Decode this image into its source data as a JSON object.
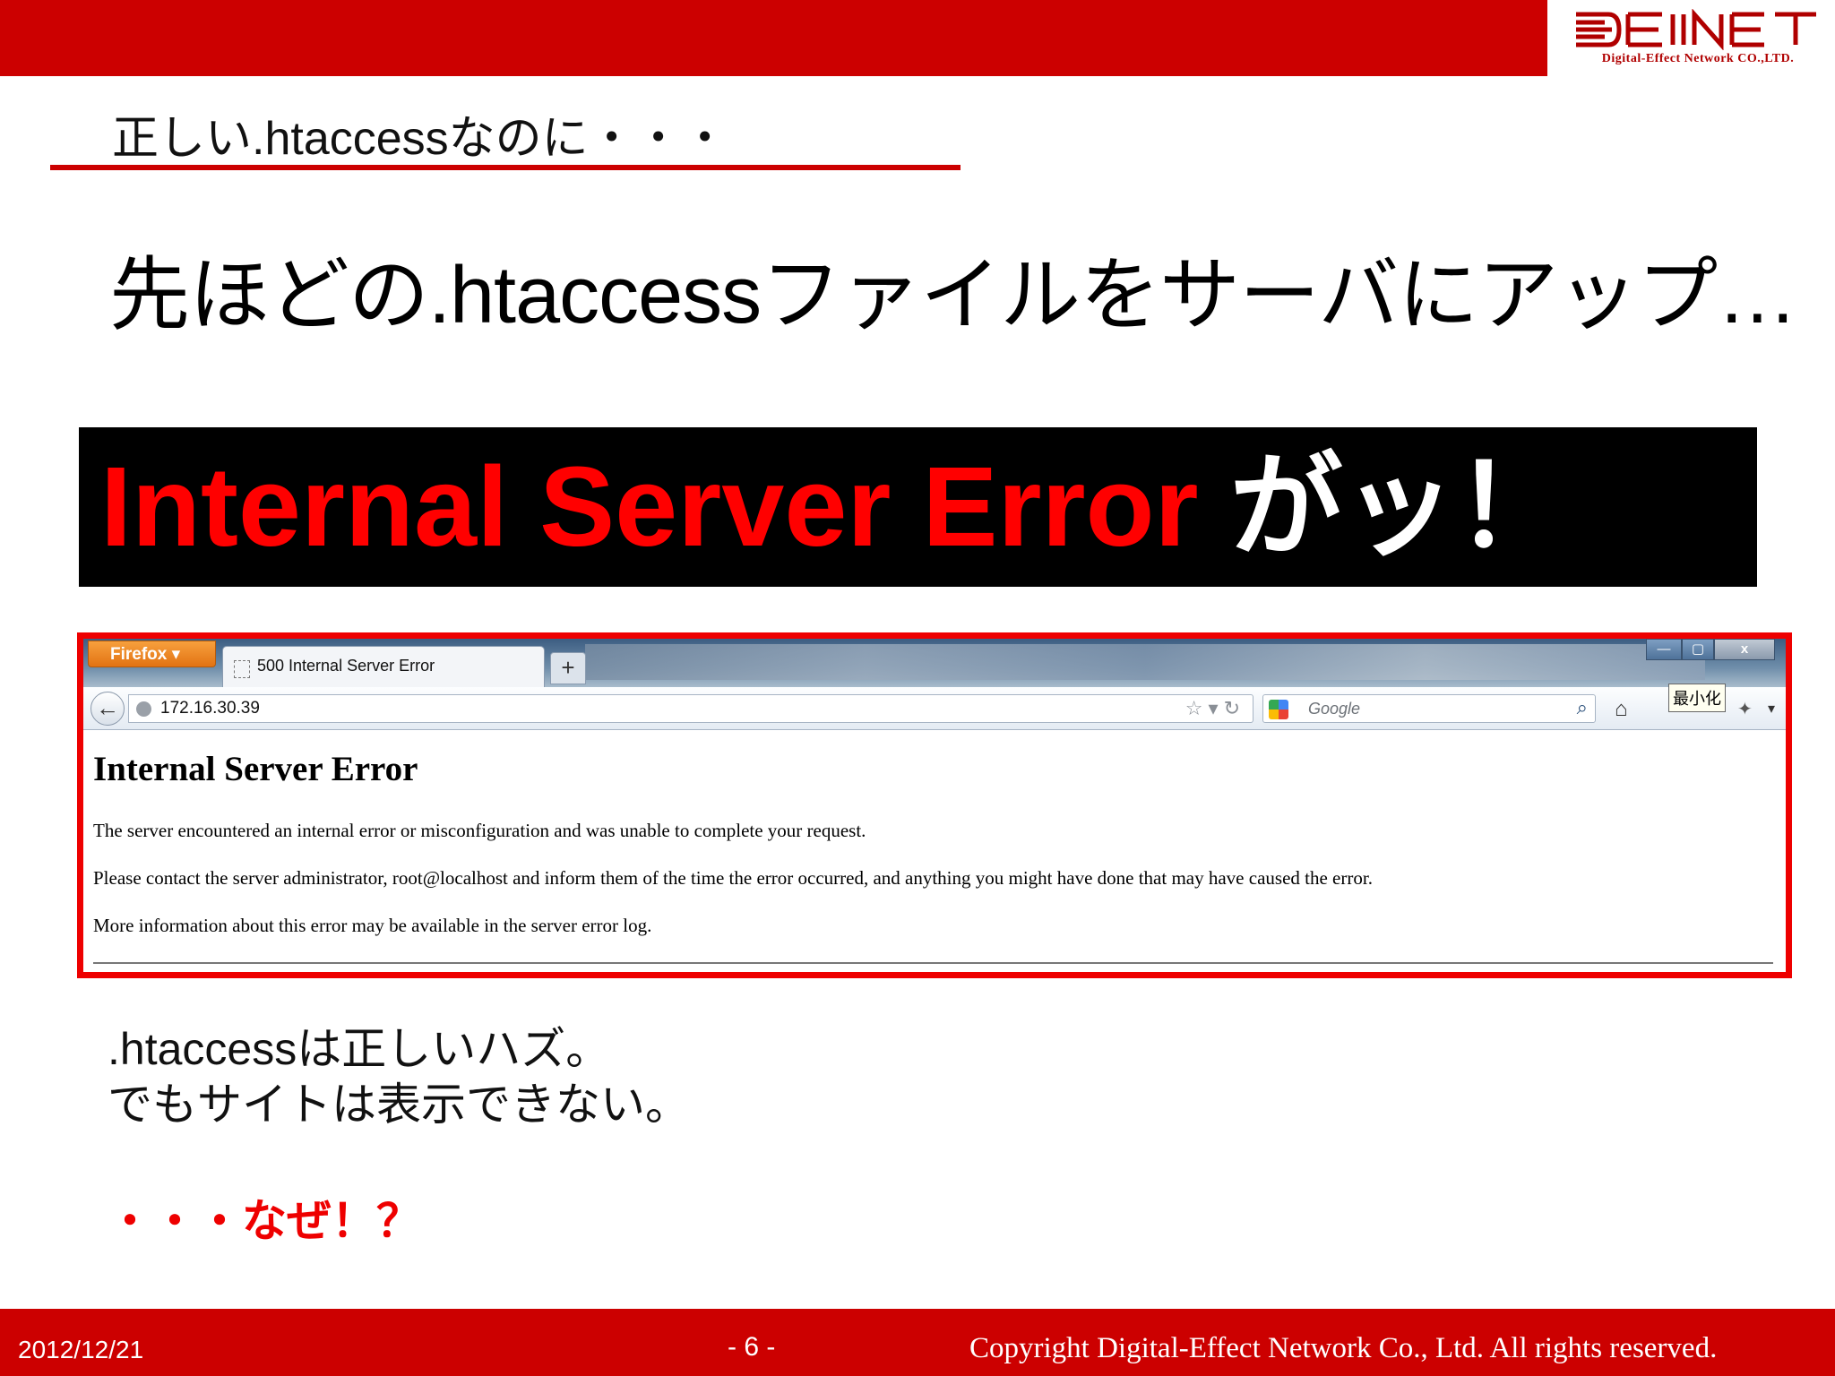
{
  "header": {
    "logo_text": "Digital-Effect Network CO.,LTD.",
    "bar_color": "#cc0000"
  },
  "slide": {
    "section_title": "正しい.htaccessなのに・・・",
    "lead": "先ほどの.htaccessファイルをサーバにアップ…",
    "banner_red": "Internal Server Error",
    "banner_white": "がッ！",
    "note_line1": ".htaccessは正しいハズ。",
    "note_line2": "でもサイトは表示できない。",
    "why": "・・・なぜ！？"
  },
  "browser": {
    "app_button": "Firefox",
    "tab_title": "500 Internal Server Error",
    "new_tab": "+",
    "url": "172.16.30.39",
    "search_placeholder": "Google",
    "tooltip": "最小化",
    "window_controls": {
      "minimize": "—",
      "maximize": "▢",
      "close": "x"
    },
    "icons": [
      "back-arrow-icon",
      "globe-icon",
      "star-icon",
      "dropdown-icon",
      "reload-icon",
      "google-icon",
      "search-icon",
      "home-icon",
      "addon-icon"
    ],
    "page": {
      "heading": "Internal Server Error",
      "paragraph1": "The server encountered an internal error or misconfiguration and was unable to complete your request.",
      "paragraph2": "Please contact the server administrator, root@localhost and inform them of the time the error occurred, and anything you might have done that may have caused the error.",
      "paragraph3": "More information about this error may be available in the server error log."
    }
  },
  "footer": {
    "date": "2012/12/21",
    "page_number": "- 6 -",
    "copyright": "Copyright Digital-Effect Network Co., Ltd. All rights reserved."
  }
}
